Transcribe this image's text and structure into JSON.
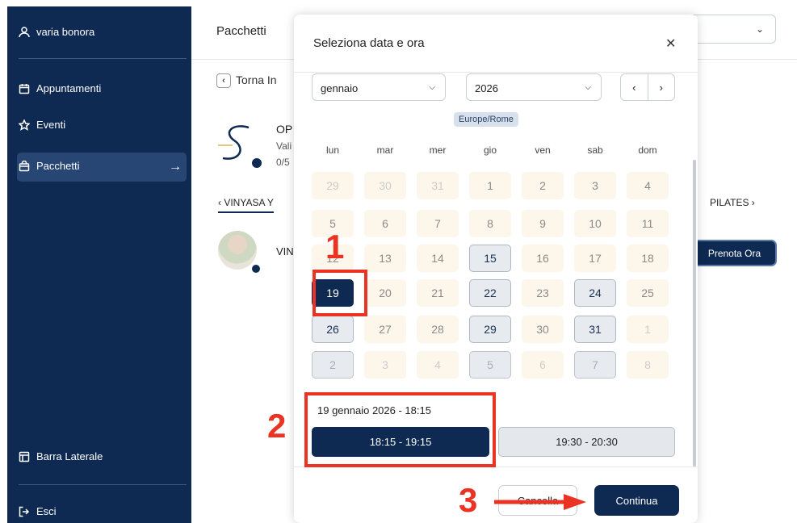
{
  "sidebar": {
    "user": "varia bonora",
    "items": [
      {
        "label": "Appuntamenti"
      },
      {
        "label": "Eventi"
      },
      {
        "label": "Pacchetti"
      }
    ],
    "toggle_label": "Barra Laterale",
    "logout_label": "Esci"
  },
  "page": {
    "title": "Pacchetti",
    "back_label": "Torna In",
    "package_title": "OP",
    "package_valid": "Vali",
    "package_count": "0/5",
    "tab_left": "VINYASA Y",
    "tab_right": "PILATES",
    "class_name": "VIN",
    "book_label": "Prenota Ora"
  },
  "modal": {
    "title": "Seleziona data e ora",
    "month": "gennaio",
    "year": "2026",
    "timezone": "Europe/Rome",
    "weekdays": [
      "lun",
      "mar",
      "mer",
      "gio",
      "ven",
      "sab",
      "dom"
    ],
    "weeks": [
      [
        {
          "d": "29",
          "s": "out"
        },
        {
          "d": "30",
          "s": "out"
        },
        {
          "d": "31",
          "s": "out"
        },
        {
          "d": "1",
          "s": "other"
        },
        {
          "d": "2",
          "s": "other"
        },
        {
          "d": "3",
          "s": "other"
        },
        {
          "d": "4",
          "s": "other"
        }
      ],
      [
        {
          "d": "5",
          "s": "other"
        },
        {
          "d": "6",
          "s": "other"
        },
        {
          "d": "7",
          "s": "other"
        },
        {
          "d": "8",
          "s": "other"
        },
        {
          "d": "9",
          "s": "other"
        },
        {
          "d": "10",
          "s": "other"
        },
        {
          "d": "11",
          "s": "other"
        }
      ],
      [
        {
          "d": "12",
          "s": "other"
        },
        {
          "d": "13",
          "s": "other"
        },
        {
          "d": "14",
          "s": "other"
        },
        {
          "d": "15",
          "s": "avail"
        },
        {
          "d": "16",
          "s": "other"
        },
        {
          "d": "17",
          "s": "other"
        },
        {
          "d": "18",
          "s": "other"
        }
      ],
      [
        {
          "d": "19",
          "s": "sel-day"
        },
        {
          "d": "20",
          "s": "other"
        },
        {
          "d": "21",
          "s": "other"
        },
        {
          "d": "22",
          "s": "avail"
        },
        {
          "d": "23",
          "s": "other"
        },
        {
          "d": "24",
          "s": "avail"
        },
        {
          "d": "25",
          "s": "other"
        }
      ],
      [
        {
          "d": "26",
          "s": "avail"
        },
        {
          "d": "27",
          "s": "other"
        },
        {
          "d": "28",
          "s": "other"
        },
        {
          "d": "29",
          "s": "avail"
        },
        {
          "d": "30",
          "s": "other"
        },
        {
          "d": "31",
          "s": "avail"
        },
        {
          "d": "1",
          "s": "out"
        }
      ],
      [
        {
          "d": "2",
          "s": "avail-other"
        },
        {
          "d": "3",
          "s": "out"
        },
        {
          "d": "4",
          "s": "out"
        },
        {
          "d": "5",
          "s": "avail-other"
        },
        {
          "d": "6",
          "s": "out"
        },
        {
          "d": "7",
          "s": "avail-other"
        },
        {
          "d": "8",
          "s": "out"
        }
      ]
    ],
    "selected_date_label": "19 gennaio 2026 - 18:15",
    "slots": [
      "18:15 - 19:15",
      "19:30 - 20:30"
    ],
    "cancel_label": "Cancella",
    "continue_label": "Continua"
  },
  "annotations": [
    "1",
    "2",
    "3"
  ],
  "colors": {
    "navy": "#0f2a52",
    "annotation": "#ea3323"
  }
}
